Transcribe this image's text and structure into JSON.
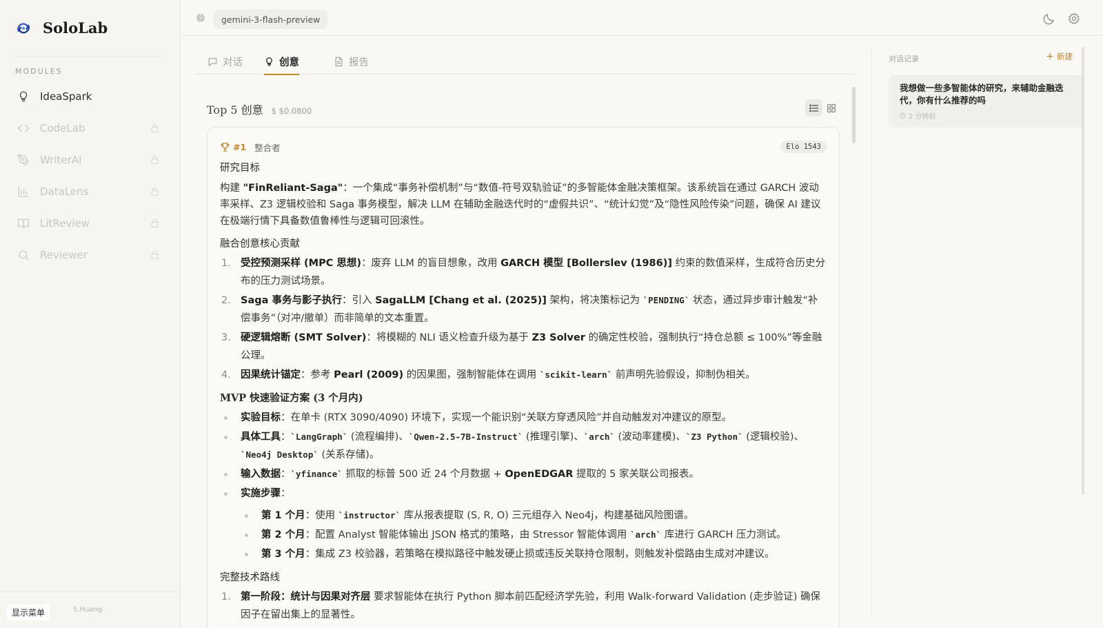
{
  "app": {
    "name": "SoloLab",
    "modules_heading": "MODULES",
    "user_name": "S.Huang",
    "show_menu_label": "显示菜单"
  },
  "sidebar": {
    "items": [
      {
        "label": "IdeaSpark",
        "icon": "lightbulb-icon",
        "state": "active"
      },
      {
        "label": "CodeLab",
        "icon": "code-icon",
        "state": "locked"
      },
      {
        "label": "WriterAI",
        "icon": "pen-icon",
        "state": "locked"
      },
      {
        "label": "DataLens",
        "icon": "bar-chart-icon",
        "state": "locked"
      },
      {
        "label": "LitReview",
        "icon": "book-icon",
        "state": "locked"
      },
      {
        "label": "Reviewer",
        "icon": "search-icon",
        "state": "locked"
      }
    ]
  },
  "topbar": {
    "model": "gemini-3-flash-preview"
  },
  "tabs": [
    {
      "label": "对话",
      "icon": "message-icon",
      "active": false
    },
    {
      "label": "创意",
      "icon": "lightbulb-icon",
      "active": true
    },
    {
      "label": "报告",
      "icon": "document-icon",
      "active": false
    }
  ],
  "results": {
    "title": "Top 5 创意",
    "cost": "$ $0.0800"
  },
  "card": {
    "rank": "#1",
    "role": "整合者",
    "elo": "Elo 1543",
    "goal_heading": "研究目标",
    "goal_p1": "构建 ",
    "goal_name": "\"FinReliant-Saga\"",
    "goal_p2": "：一个集成“事务补偿机制”与“数值-符号双轨验证”的多智能体金融决策框架。该系统旨在通过 GARCH 波动率采样、Z3 逻辑校验和 Saga 事务模型，解决 LLM 在辅助金融迭代时的“虚假共识”、“统计幻觉”及“隐性风险传染”问题，确保 AI 建议在极端行情下具备数值鲁棒性与逻辑可回滚性。",
    "contrib_heading": "融合创意核心贡献",
    "contrib": [
      {
        "n": "1.",
        "b1": "受控预测采样 (MPC 思想)",
        "t1": "：废弃 LLM 的盲目想象，改用 ",
        "b2": "GARCH 模型 [Bollerslev (1986)]",
        "t2": " 约束的数值采样，生成符合历史分布的压力测试场景。"
      },
      {
        "n": "2.",
        "b1": "Saga 事务与影子执行",
        "t1": "：引入 ",
        "b2": "SagaLLM [Chang et al. (2025)]",
        "t2": " 架构，将决策标记为 ",
        "c": "`PENDING`",
        "t3": " 状态，通过异步审计触发“补偿事务”（对冲/撤单）而非简单的文本重置。"
      },
      {
        "n": "3.",
        "b1": "硬逻辑熔断 (SMT Solver)",
        "t1": "：将模糊的 NLI 语义检查升级为基于 ",
        "b2": "Z3 Solver",
        "t2": " 的确定性校验，强制执行“持仓总额 ≤ 100%”等金融公理。"
      },
      {
        "n": "4.",
        "b1": "因果统计锚定",
        "t1": "：参考 ",
        "b2": "Pearl (2009)",
        "t2": " 的因果图，强制智能体在调用 ",
        "c": "`scikit-learn`",
        "t3": " 前声明先验假设，抑制伪相关。"
      }
    ],
    "mvp_heading": "MVP 快速验证方案 (3 个月内)",
    "mvp": {
      "goal_b": "实验目标",
      "goal_t": "：在单卡 (RTX 3090/4090) 环境下，实现一个能识别“关联方穿透风险”并自动触发对冲建议的原型。",
      "tools_b": "具体工具",
      "tools_c1": "`LangGraph`",
      "tools_t1": " (流程编排)、",
      "tools_c2": "`Qwen-2.5-7B-Instruct`",
      "tools_t2": " (推理引擎)、",
      "tools_c3": "`arch`",
      "tools_t3": " (波动率建模)、",
      "tools_c4": "`Z3 Python`",
      "tools_t4": " (逻辑校验)、",
      "tools_c5": "`Neo4j Desktop`",
      "tools_t5": " (关系存储)。",
      "input_b": "输入数据",
      "input_c": "`yfinance`",
      "input_t1": " 抓取的标普 500 近 24 个月数据 + ",
      "input_b2": "OpenEDGAR",
      "input_t2": " 提取的 5 家关联公司报表。",
      "steps_b": "实施步骤",
      "steps_t": "：",
      "steps": [
        {
          "b": "第 1 个月",
          "t1": "：使用 ",
          "c": "`instructor`",
          "t2": " 库从报表提取 (S, R, O) 三元组存入 Neo4j，构建基础风险图谱。"
        },
        {
          "b": "第 2 个月",
          "t1": "：配置 Analyst 智能体输出 JSON 格式的策略，由 Stressor 智能体调用 ",
          "c": "`arch`",
          "t2": " 库进行 GARCH 压力测试。"
        },
        {
          "b": "第 3 个月",
          "t1": "：集成 Z3 校验器，若策略在模拟路径中触发硬止损或违反关联持仓限制，则触发补偿路由生成对冲建议。",
          "c": "",
          "t2": ""
        }
      ]
    },
    "route_heading": "完整技术路线",
    "route": [
      {
        "n": "1.",
        "b": "第一阶段：统计与因果对齐层",
        "t": " 要求智能体在执行 Python 脚本前匹配经济学先验，利用 Walk-forward Validation (走步验证) 确保因子在留出集上的显著性。"
      }
    ]
  },
  "history": {
    "title": "对话记录",
    "new_label": "新建",
    "items": [
      {
        "text": "我想做一些多智能体的研究，来辅助金融迭代，你有什么推荐的吗",
        "time": "2 分钟前"
      }
    ]
  }
}
